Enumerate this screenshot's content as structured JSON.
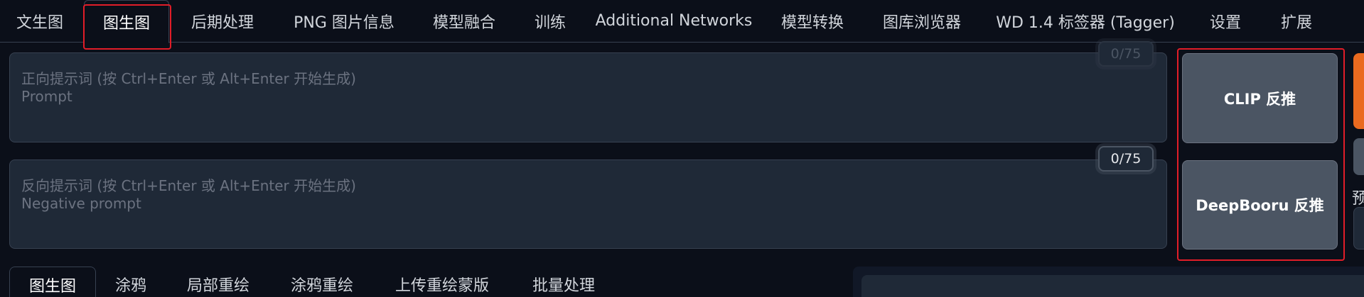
{
  "top_tabs": [
    {
      "label": "文生图"
    },
    {
      "label": "图生图",
      "active": true
    },
    {
      "label": "后期处理"
    },
    {
      "label": "PNG 图片信息"
    },
    {
      "label": "模型融合"
    },
    {
      "label": "训练"
    },
    {
      "label": "Additional Networks"
    },
    {
      "label": "模型转换"
    },
    {
      "label": "图库浏览器"
    },
    {
      "label": "WD 1.4 标签器 (Tagger)"
    },
    {
      "label": "设置"
    },
    {
      "label": "扩展"
    }
  ],
  "prompt": {
    "placeholder_line1": "正向提示词 (按 Ctrl+Enter 或 Alt+Enter 开始生成)",
    "placeholder_line2": "Prompt",
    "token_count": "0/75"
  },
  "negative_prompt": {
    "placeholder_line1": "反向提示词 (按 Ctrl+Enter 或 Alt+Enter 开始生成)",
    "placeholder_line2": "Negative prompt",
    "token_count": "0/75"
  },
  "interrogate": {
    "clip_label": "CLIP 反推",
    "deepbooru_label": "DeepBooru 反推"
  },
  "preset_label_partial": "预",
  "sub_tabs": [
    {
      "label": "图生图",
      "active": true
    },
    {
      "label": "涂鸦"
    },
    {
      "label": "局部重绘"
    },
    {
      "label": "涂鸦重绘"
    },
    {
      "label": "上传重绘蒙版"
    },
    {
      "label": "批量处理"
    }
  ],
  "colors": {
    "background": "#0b0f19",
    "highlight_red": "#e11d28",
    "generate_orange": "#ea6a1f"
  }
}
